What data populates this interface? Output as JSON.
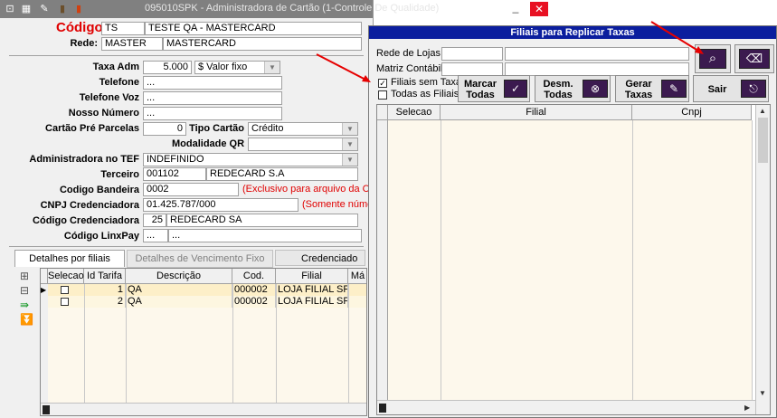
{
  "window": {
    "title": "095010SPK - Administradora de Cartão (1-Controle De Qualidade)"
  },
  "form": {
    "codigo_label": "Código",
    "codigo_code": "TS",
    "codigo_desc": "TESTE QA - MASTERCARD",
    "rede_label": "Rede:",
    "rede_code": "MASTER",
    "rede_desc": "MASTERCARD",
    "taxa_adm_label": "Taxa Adm",
    "taxa_adm_value": "5.000",
    "taxa_tipo": "$  Valor fixo",
    "telefone_label": "Telefone",
    "telefone_value": "...",
    "telefone_voz_label": "Telefone Voz",
    "telefone_voz_value": "...",
    "nosso_numero_label": "Nosso Número",
    "nosso_numero_value": "...",
    "cartao_pre_label": "Cartão Pré Parcelas",
    "cartao_pre_value": "0",
    "tipo_cartao_label": "Tipo Cartão",
    "tipo_cartao_value": "Crédito",
    "modalidade_label": "Modalidade QR",
    "modalidade_value": "",
    "adm_tef_label": "Administradora no TEF",
    "adm_tef_value": "INDEFINIDO",
    "terceiro_label": "Terceiro",
    "terceiro_code": "001102",
    "terceiro_desc": "REDECARD S.A",
    "cod_bandeira_label": "Codigo Bandeira",
    "cod_bandeira_value": "0002",
    "cod_bandeira_note": "(Exclusivo para arquivo da CI",
    "cnpj_label": "CNPJ Credenciadora",
    "cnpj_value": "01.425.787/000",
    "cnpj_note": "(Somente núme",
    "cod_cred_label": "Código Credenciadora",
    "cod_cred_code": "25",
    "cod_cred_desc": "REDECARD SA",
    "linxpay_label": "Código LinxPay",
    "linxpay_a": "...",
    "linxpay_b": "..."
  },
  "tabs": [
    "Detalhes por filiais",
    "Detalhes de Vencimento Fixo",
    "Credenciado"
  ],
  "grid": {
    "columns": [
      "Selecao",
      "Id Tarifa",
      "Descrição",
      "Cod. Filial",
      "Filial",
      "Má"
    ],
    "rows": [
      {
        "id": "1",
        "descricao": "QA",
        "cod_filial": "000002",
        "filial": "LOJA FILIAL SP"
      },
      {
        "id": "2",
        "descricao": "QA",
        "cod_filial": "000002",
        "filial": "LOJA FILIAL SP"
      }
    ]
  },
  "dialog": {
    "title": "Filiais para Replicar Taxas",
    "rede_label": "Rede de Lojas:",
    "rede_value": "",
    "matriz_label": "Matriz Contábil:",
    "matriz_value": "",
    "filiais_sem_taxa": "Filiais sem Taxa",
    "todas_filiais": "Todas as Filiais",
    "btn_marcar_1": "Marcar",
    "btn_marcar_2": "Todas",
    "btn_desm_1": "Desm.",
    "btn_desm_2": "Todas",
    "btn_gerar_1": "Gerar",
    "btn_gerar_2": "Taxas",
    "btn_sair": "Sair",
    "columns": [
      "Selecao",
      "Filial",
      "Cnpj"
    ]
  },
  "colors": {
    "dialog_title_bg": "#0b1e9e",
    "icon_button_bg": "#3b1a4f",
    "arrow": "#e60000",
    "required_label": "#e00000"
  }
}
